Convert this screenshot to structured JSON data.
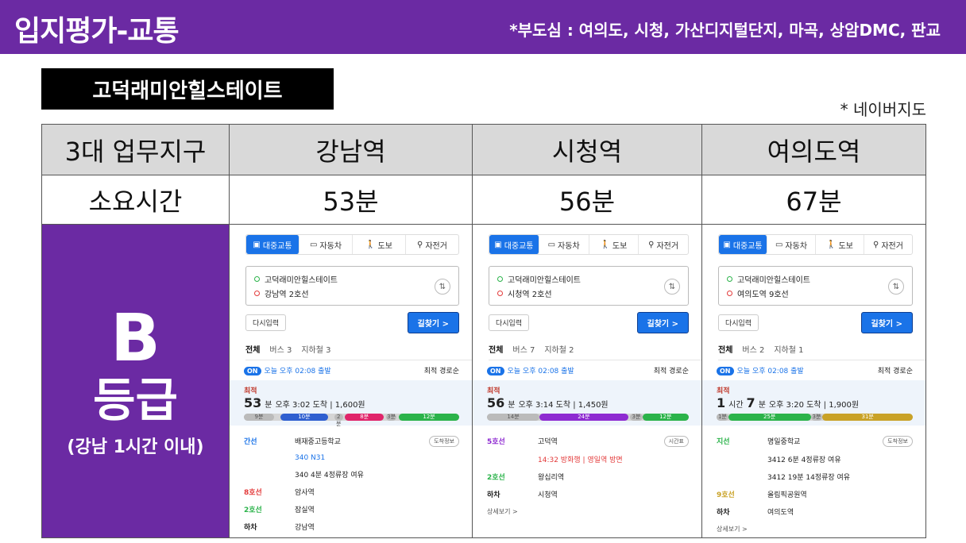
{
  "header": {
    "title": "입지평가-교통",
    "sub": "*부도심 : 여의도, 시청, 가산디지털단지, 마곡, 상암DMC, 판교"
  },
  "apartment": "고덕래미안힐스테이트",
  "note": "* 네이버지도",
  "table": {
    "col_header": "3대 업무지구",
    "row_time": "소요시간",
    "destinations": [
      {
        "name": "강남역",
        "time": "53분"
      },
      {
        "name": "시청역",
        "time": "56분"
      },
      {
        "name": "여의도역",
        "time": "67분"
      }
    ],
    "grade": {
      "letter": "B",
      "word": "등급",
      "desc": "(강남 1시간 이내)"
    }
  },
  "screens": {
    "tabs": [
      "대중교통",
      "자동차",
      "도보",
      "자전거"
    ],
    "origin": "고덕래미안힐스테이트",
    "reinput": "다시입력",
    "find": "길찾기 >",
    "depart": "오늘 오후 02:08 출발",
    "on": "ON",
    "sort": "최적 경로순",
    "best": "최적",
    "more": "상세보기 >",
    "gangnam": {
      "dest": "강남역 2호선",
      "subtabs": [
        "전체",
        "버스 3",
        "지하철 3"
      ],
      "time_big": "53",
      "time_unit": "분",
      "arrive": "오후 3:02 도착 | 1,600원",
      "segs": [
        "9분",
        "10분",
        "2분",
        "8분",
        "3분",
        "12분"
      ],
      "steps": [
        {
          "line": "간선",
          "text": "배재중고등학교",
          "extra": "도착정보"
        },
        {
          "line": "",
          "text": "340  N31",
          "extra": ""
        },
        {
          "line": "",
          "text": "340  4분 4정류장 여유",
          "extra": ""
        },
        {
          "line": "8호선",
          "text": "암사역",
          "extra": ""
        },
        {
          "line": "2호선",
          "text": "잠실역",
          "extra": ""
        },
        {
          "line": "하차",
          "text": "강남역",
          "extra": ""
        }
      ]
    },
    "cityhall": {
      "dest": "시청역 2호선",
      "subtabs": [
        "전체",
        "버스 7",
        "지하철 2"
      ],
      "time_big": "56",
      "time_unit": "분",
      "arrive": "오후 3:14 도착 | 1,450원",
      "segs": [
        "14분",
        "24분",
        "3분",
        "12분"
      ],
      "steps": [
        {
          "line": "5호선",
          "text": "고덕역",
          "extra": "시간표"
        },
        {
          "line": "",
          "text": "14:32 방화행 | 영일역 방면",
          "extra": ""
        },
        {
          "line": "2호선",
          "text": "왕십리역",
          "extra": ""
        },
        {
          "line": "하차",
          "text": "시청역",
          "extra": ""
        }
      ]
    },
    "yeouido": {
      "dest": "여의도역 9호선",
      "subtabs": [
        "전체",
        "버스 2",
        "지하철 1"
      ],
      "time_big": "1",
      "time_unit": "시간",
      "time_big2": "7",
      "time_unit2": "분",
      "arrive": "오후 3:20 도착 | 1,900원",
      "segs": [
        "1분",
        "25분",
        "3분",
        "31분"
      ],
      "steps": [
        {
          "line": "지선",
          "text": "명일중학교",
          "extra": "도착정보"
        },
        {
          "line": "",
          "text": "3412  6분 4정류장 여유",
          "extra": ""
        },
        {
          "line": "",
          "text": "3412  19분 14정류장 여유",
          "extra": ""
        },
        {
          "line": "9호선",
          "text": "올림픽공원역",
          "extra": ""
        },
        {
          "line": "하차",
          "text": "여의도역",
          "extra": ""
        }
      ]
    }
  }
}
